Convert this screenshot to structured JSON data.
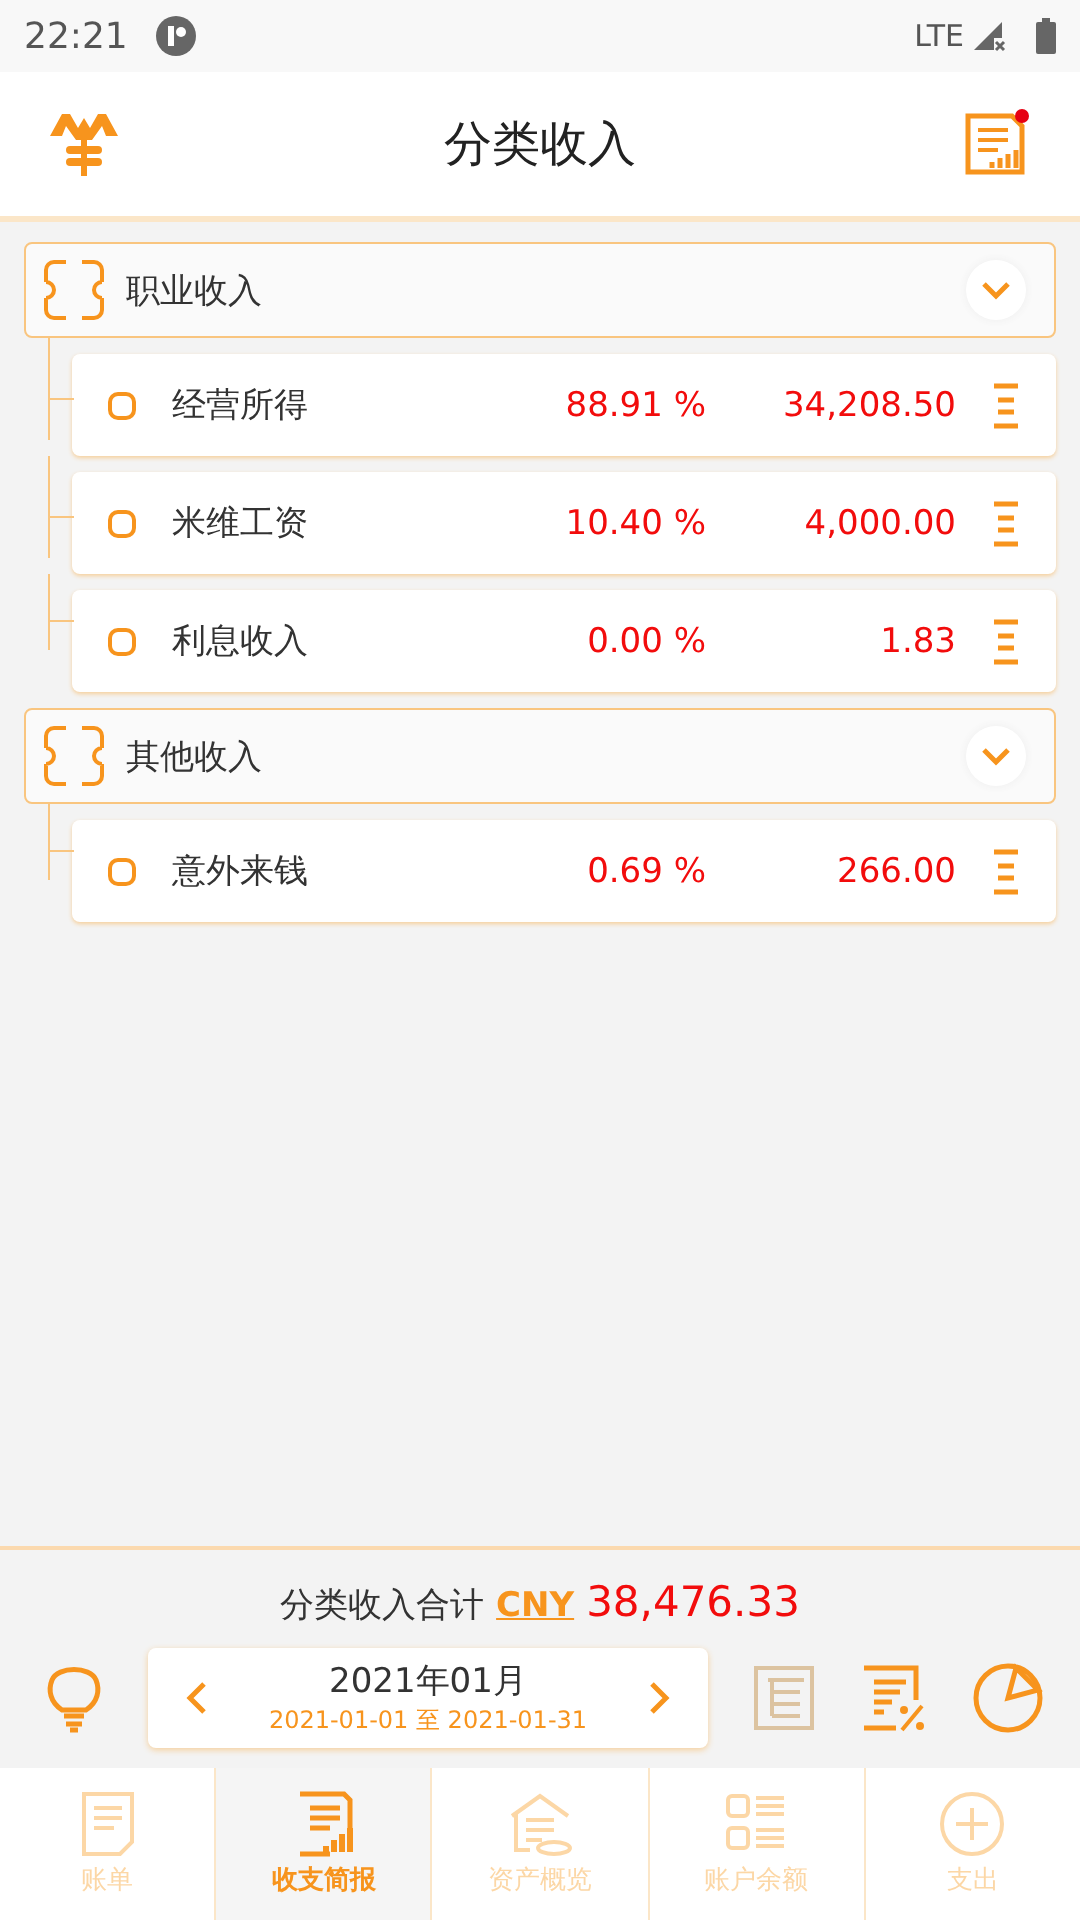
{
  "status_bar": {
    "time": "22:21",
    "network": "LTE"
  },
  "header": {
    "title": "分类收入"
  },
  "groups": [
    {
      "name": "职业收入",
      "expanded": true,
      "items": [
        {
          "name": "经营所得",
          "percent": "88.91 %",
          "amount": "34,208.50"
        },
        {
          "name": "米维工资",
          "percent": "10.40 %",
          "amount": "4,000.00"
        },
        {
          "name": "利息收入",
          "percent": "0.00 %",
          "amount": "1.83"
        }
      ]
    },
    {
      "name": "其他收入",
      "expanded": true,
      "items": [
        {
          "name": "意外来钱",
          "percent": "0.69 %",
          "amount": "266.00"
        }
      ]
    }
  ],
  "summary": {
    "label": "分类收入合计",
    "currency": "CNY",
    "total": "38,476.33"
  },
  "period": {
    "month": "2021年01月",
    "start": "2021-01-01",
    "separator": "至",
    "end": "2021-01-31"
  },
  "nav": [
    {
      "label": "账单",
      "selected": false
    },
    {
      "label": "收支简报",
      "selected": true
    },
    {
      "label": "资产概览",
      "selected": false
    },
    {
      "label": "账户余额",
      "selected": false
    },
    {
      "label": "支出",
      "selected": false
    }
  ]
}
